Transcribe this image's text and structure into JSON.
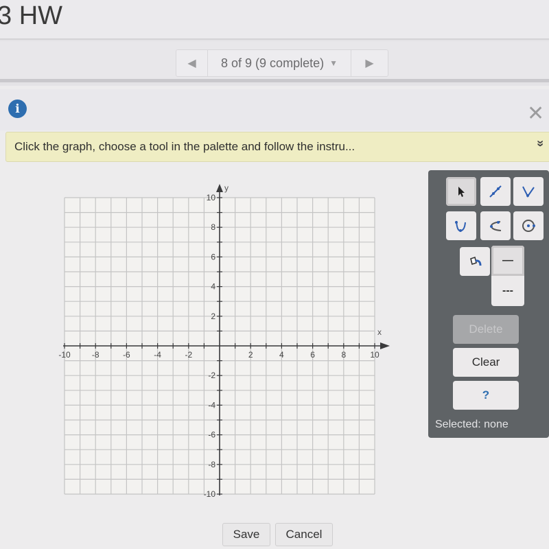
{
  "header": {
    "title": "3 HW"
  },
  "pager": {
    "prev_icon": "triangle-left-icon",
    "label": "8 of 9 (9 complete)",
    "dropdown_icon": "caret-down-icon",
    "next_icon": "triangle-right-icon"
  },
  "question": {
    "info_icon_glyph": "i",
    "close_glyph": "✕",
    "instruction": "Click the graph, choose a tool in the palette and follow the instru...",
    "expand_glyph": "»"
  },
  "graph": {
    "x_axis_label": "x",
    "y_axis_label": "y",
    "x_range": [
      -10,
      10
    ],
    "y_range": [
      -10,
      10
    ],
    "grid_step": 1,
    "x_tick_labels": [
      "-10",
      "-8",
      "-6",
      "-4",
      "-2",
      "2",
      "4",
      "6",
      "8",
      "10"
    ],
    "y_tick_labels": [
      "10",
      "8",
      "6",
      "4",
      "2",
      "-2",
      "-4",
      "-6",
      "-8",
      "-10"
    ],
    "colors": {
      "grid": "#c4c4c4",
      "axis": "#3a3a3c",
      "background": "#f3f2f0"
    }
  },
  "palette": {
    "tools": [
      {
        "name": "select-tool",
        "icon": "arrow-cursor-icon",
        "selected": true
      },
      {
        "name": "line-tool",
        "icon": "line-segment-icon",
        "selected": false
      },
      {
        "name": "absolute-value-tool",
        "icon": "v-shape-icon",
        "selected": false
      },
      {
        "name": "parabola-tool",
        "icon": "parabola-icon",
        "selected": false
      },
      {
        "name": "hyperbola-tool",
        "icon": "sideways-parabola-icon",
        "selected": false
      },
      {
        "name": "circle-tool",
        "icon": "circle-icon",
        "selected": false
      },
      {
        "name": "fill-tool",
        "icon": "paint-bucket-icon",
        "selected": false
      }
    ],
    "line_styles": {
      "solid_glyph": "—",
      "dashed_glyph": "---",
      "selected": "solid"
    },
    "delete_label": "Delete",
    "delete_enabled": false,
    "clear_label": "Clear",
    "help_label": "?",
    "status": "Selected: none",
    "accent_color": "#2e5fb3"
  },
  "footer": {
    "save_label": "Save",
    "cancel_label": "Cancel"
  }
}
